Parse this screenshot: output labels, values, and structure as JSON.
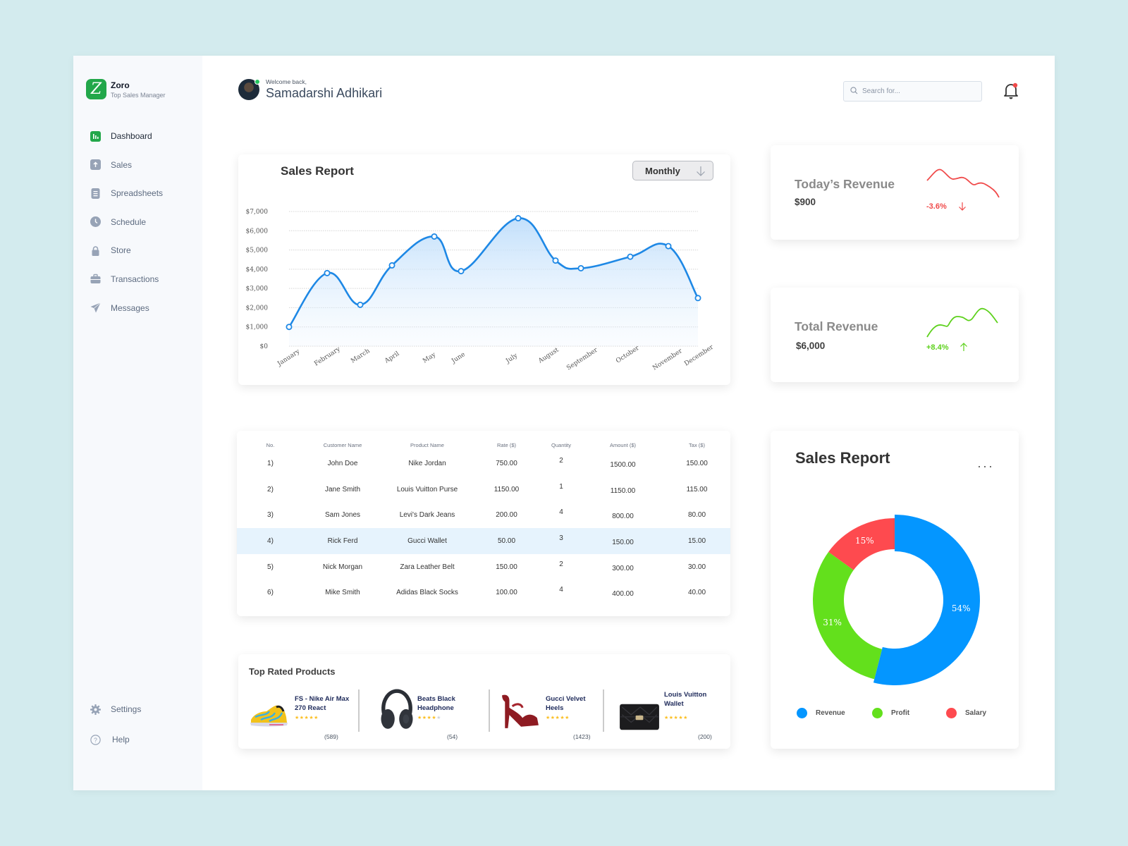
{
  "brand": {
    "name": "Zoro",
    "subtitle": "Top Sales Manager",
    "logo_letter": "Z",
    "color": "#22a74a"
  },
  "sidebar": {
    "items": [
      {
        "label": "Dashboard",
        "icon": "bar-chart-icon",
        "active": true
      },
      {
        "label": "Sales",
        "icon": "arrow-up-icon"
      },
      {
        "label": "Spreadsheets",
        "icon": "document-icon"
      },
      {
        "label": "Schedule",
        "icon": "clock-icon"
      },
      {
        "label": "Store",
        "icon": "lock-icon"
      },
      {
        "label": "Transactions",
        "icon": "briefcase-icon"
      },
      {
        "label": "Messages",
        "icon": "paper-plane-icon"
      }
    ],
    "bottom": [
      {
        "label": "Settings",
        "icon": "gear-icon"
      },
      {
        "label": "Help",
        "icon": "help-icon"
      }
    ]
  },
  "header": {
    "welcome": "Welcome back,",
    "user_name": "Samadarshi Adhikari",
    "online": true,
    "search_placeholder": "Search for...",
    "notification_unread": true
  },
  "sales_report": {
    "title": "Sales Report",
    "period_select": "Monthly"
  },
  "chart_data": [
    {
      "type": "area",
      "title": "Sales Report",
      "categories": [
        "January",
        "February",
        "March",
        "April",
        "May",
        "June",
        "July",
        "August",
        "September",
        "October",
        "November",
        "December"
      ],
      "values": [
        1000,
        3800,
        2150,
        4200,
        5700,
        3900,
        6650,
        4450,
        4050,
        4650,
        5200,
        2500
      ],
      "y_ticks": [
        "$0",
        "$1,000",
        "$2,000",
        "$3,000",
        "$4,000",
        "$5,000",
        "$6,000",
        "$7,000"
      ],
      "ylim": [
        0,
        7000
      ],
      "xlabel": "",
      "ylabel": "",
      "grid": true,
      "color": "#1e88e5"
    },
    {
      "type": "pie",
      "title": "Sales Report",
      "categories": [
        "Revenue",
        "Profit",
        "Salary"
      ],
      "values": [
        54,
        31,
        15
      ],
      "labels": [
        "54%",
        "31%",
        "15%"
      ],
      "colors": [
        "#0496ff",
        "#63e01c",
        "#fe4a4f"
      ],
      "legend": "bottom"
    }
  ],
  "todays_revenue": {
    "title": "Today’s Revenue",
    "value": "$900",
    "change": "-3.6%",
    "direction": "down",
    "color": "#f04a4a"
  },
  "total_revenue": {
    "title": "Total Revenue",
    "value": "$6,000",
    "change": "+8.4%",
    "direction": "up",
    "color": "#5dd11c"
  },
  "table": {
    "columns": [
      "No.",
      "Customer Name",
      "Product Name",
      "Rate ($)",
      "Quantity",
      "Amount  ($)",
      "Tax ($)"
    ],
    "rows": [
      [
        "1)",
        "John Doe",
        "Nike Jordan",
        "750.00",
        "2",
        "1500.00",
        "150.00"
      ],
      [
        "2)",
        "Jane Smith",
        "Louis Vuitton Purse",
        "1150.00",
        "1",
        "1150.00",
        "115.00"
      ],
      [
        "3)",
        "Sam Jones",
        "Levi's Dark Jeans",
        "200.00",
        "4",
        "800.00",
        "80.00"
      ],
      [
        "4)",
        "Rick Ferd",
        "Gucci Wallet",
        "50.00",
        "3",
        "150.00",
        "15.00"
      ],
      [
        "5)",
        "Nick Morgan",
        "Zara Leather Belt",
        "150.00",
        "2",
        "300.00",
        "30.00"
      ],
      [
        "6)",
        "Mike Smith",
        "Adidas Black Socks",
        "100.00",
        "4",
        "400.00",
        "40.00"
      ]
    ],
    "highlighted_row": 3
  },
  "top_rated": {
    "title": "Top Rated Products",
    "products": [
      {
        "name": "FS - Nike Air Max 270 React",
        "rating": 5,
        "reviews": "(589)",
        "image": "sneaker"
      },
      {
        "name": "Beats Black Headphone",
        "rating": 4,
        "reviews": "(54)",
        "image": "headphones"
      },
      {
        "name": "Gucci Velvet Heels",
        "rating": 5,
        "reviews": "(1423)",
        "image": "heels"
      },
      {
        "name": "Louis Vuitton Wallet",
        "rating": 5,
        "reviews": "(200)",
        "image": "wallet"
      }
    ]
  },
  "donut": {
    "title": "Sales Report",
    "menu": "···"
  }
}
